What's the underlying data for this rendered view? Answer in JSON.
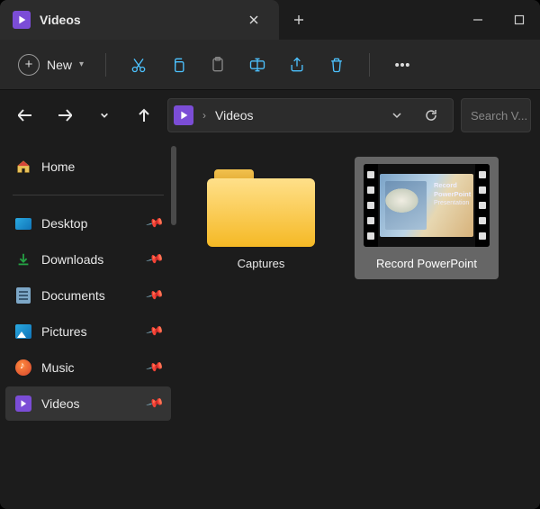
{
  "titlebar": {
    "tab_title": "Videos",
    "tab_icon": "videos-icon",
    "close_icon": "close-icon",
    "newtab_icon": "plus-icon",
    "minimize_icon": "minimize-icon",
    "maximize_icon": "maximize-icon"
  },
  "toolbar": {
    "new_label": "New",
    "items": [
      {
        "name": "cut-icon"
      },
      {
        "name": "copy-icon"
      },
      {
        "name": "paste-icon"
      },
      {
        "name": "rename-icon"
      },
      {
        "name": "share-icon"
      },
      {
        "name": "delete-icon"
      }
    ],
    "more_icon": "more-icon"
  },
  "nav": {
    "back_icon": "back-icon",
    "forward_icon": "forward-icon",
    "recent_icon": "chevron-down-icon",
    "up_icon": "up-icon",
    "refresh_icon": "refresh-icon",
    "dropdown_icon": "chevron-down-icon"
  },
  "address": {
    "icon": "videos-icon",
    "crumbs": [
      "Videos"
    ]
  },
  "search": {
    "placeholder": "Search V..."
  },
  "sidebar": {
    "items": [
      {
        "label": "Home",
        "icon": "home-icon",
        "pinned": false,
        "active": false
      },
      {
        "label": "Desktop",
        "icon": "desktop-icon",
        "pinned": true,
        "active": false
      },
      {
        "label": "Downloads",
        "icon": "downloads-icon",
        "pinned": true,
        "active": false
      },
      {
        "label": "Documents",
        "icon": "documents-icon",
        "pinned": true,
        "active": false
      },
      {
        "label": "Pictures",
        "icon": "pictures-icon",
        "pinned": true,
        "active": false
      },
      {
        "label": "Music",
        "icon": "music-icon",
        "pinned": true,
        "active": false
      },
      {
        "label": "Videos",
        "icon": "videos-icon",
        "pinned": true,
        "active": true
      }
    ]
  },
  "content": {
    "items": [
      {
        "type": "folder",
        "label": "Captures",
        "selected": false
      },
      {
        "type": "video",
        "label": "Record PowerPoint",
        "selected": true,
        "slide_title": "Record PowerPoint",
        "slide_sub": "Presentation"
      }
    ]
  },
  "colors": {
    "accent": "#4cc2ff",
    "purple": "#7b4dd6",
    "bg": "#1c1c1c",
    "panel": "#2c2c2c"
  }
}
